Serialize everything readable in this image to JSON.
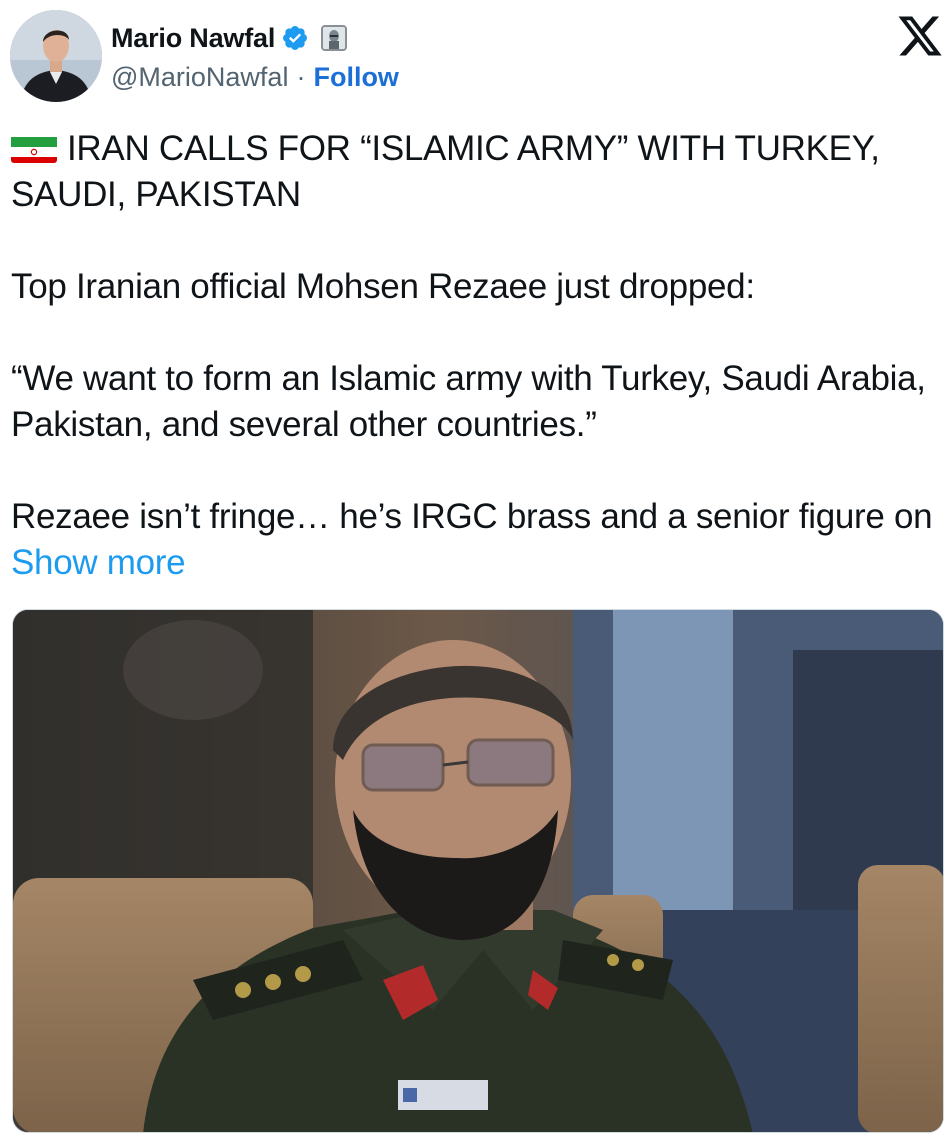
{
  "post": {
    "author": {
      "display_name": "Mario Nawfal",
      "handle": "@MarioNawfal",
      "separator": "·",
      "follow_label": "Follow",
      "verified_icon": "verified-badge-icon",
      "affiliate_icon": "affiliate-badge-icon"
    },
    "platform_logo": "x-logo-icon",
    "flag_icon": "iran-flag-icon",
    "text": {
      "headline": "IRAN CALLS FOR “ISLAMIC ARMY” WITH TURKEY, SAUDI, PAKISTAN",
      "para1": "Top Iranian official Mohsen Rezaee just dropped:",
      "para2": "“We want to form an Islamic army with Turkey, Saudi Arabia, Pakistan, and several other countries.”",
      "para3": "Rezaee isn’t fringe… he’s IRGC brass and a senior figure on",
      "show_more": "Show more"
    },
    "media": {
      "description_icon": "photo-uniformed-official"
    }
  },
  "colors": {
    "text": "#0f1419",
    "secondary": "#536471",
    "follow": "#1d6fd8",
    "link": "#1d9bf0",
    "verified": "#1d9bf0"
  }
}
